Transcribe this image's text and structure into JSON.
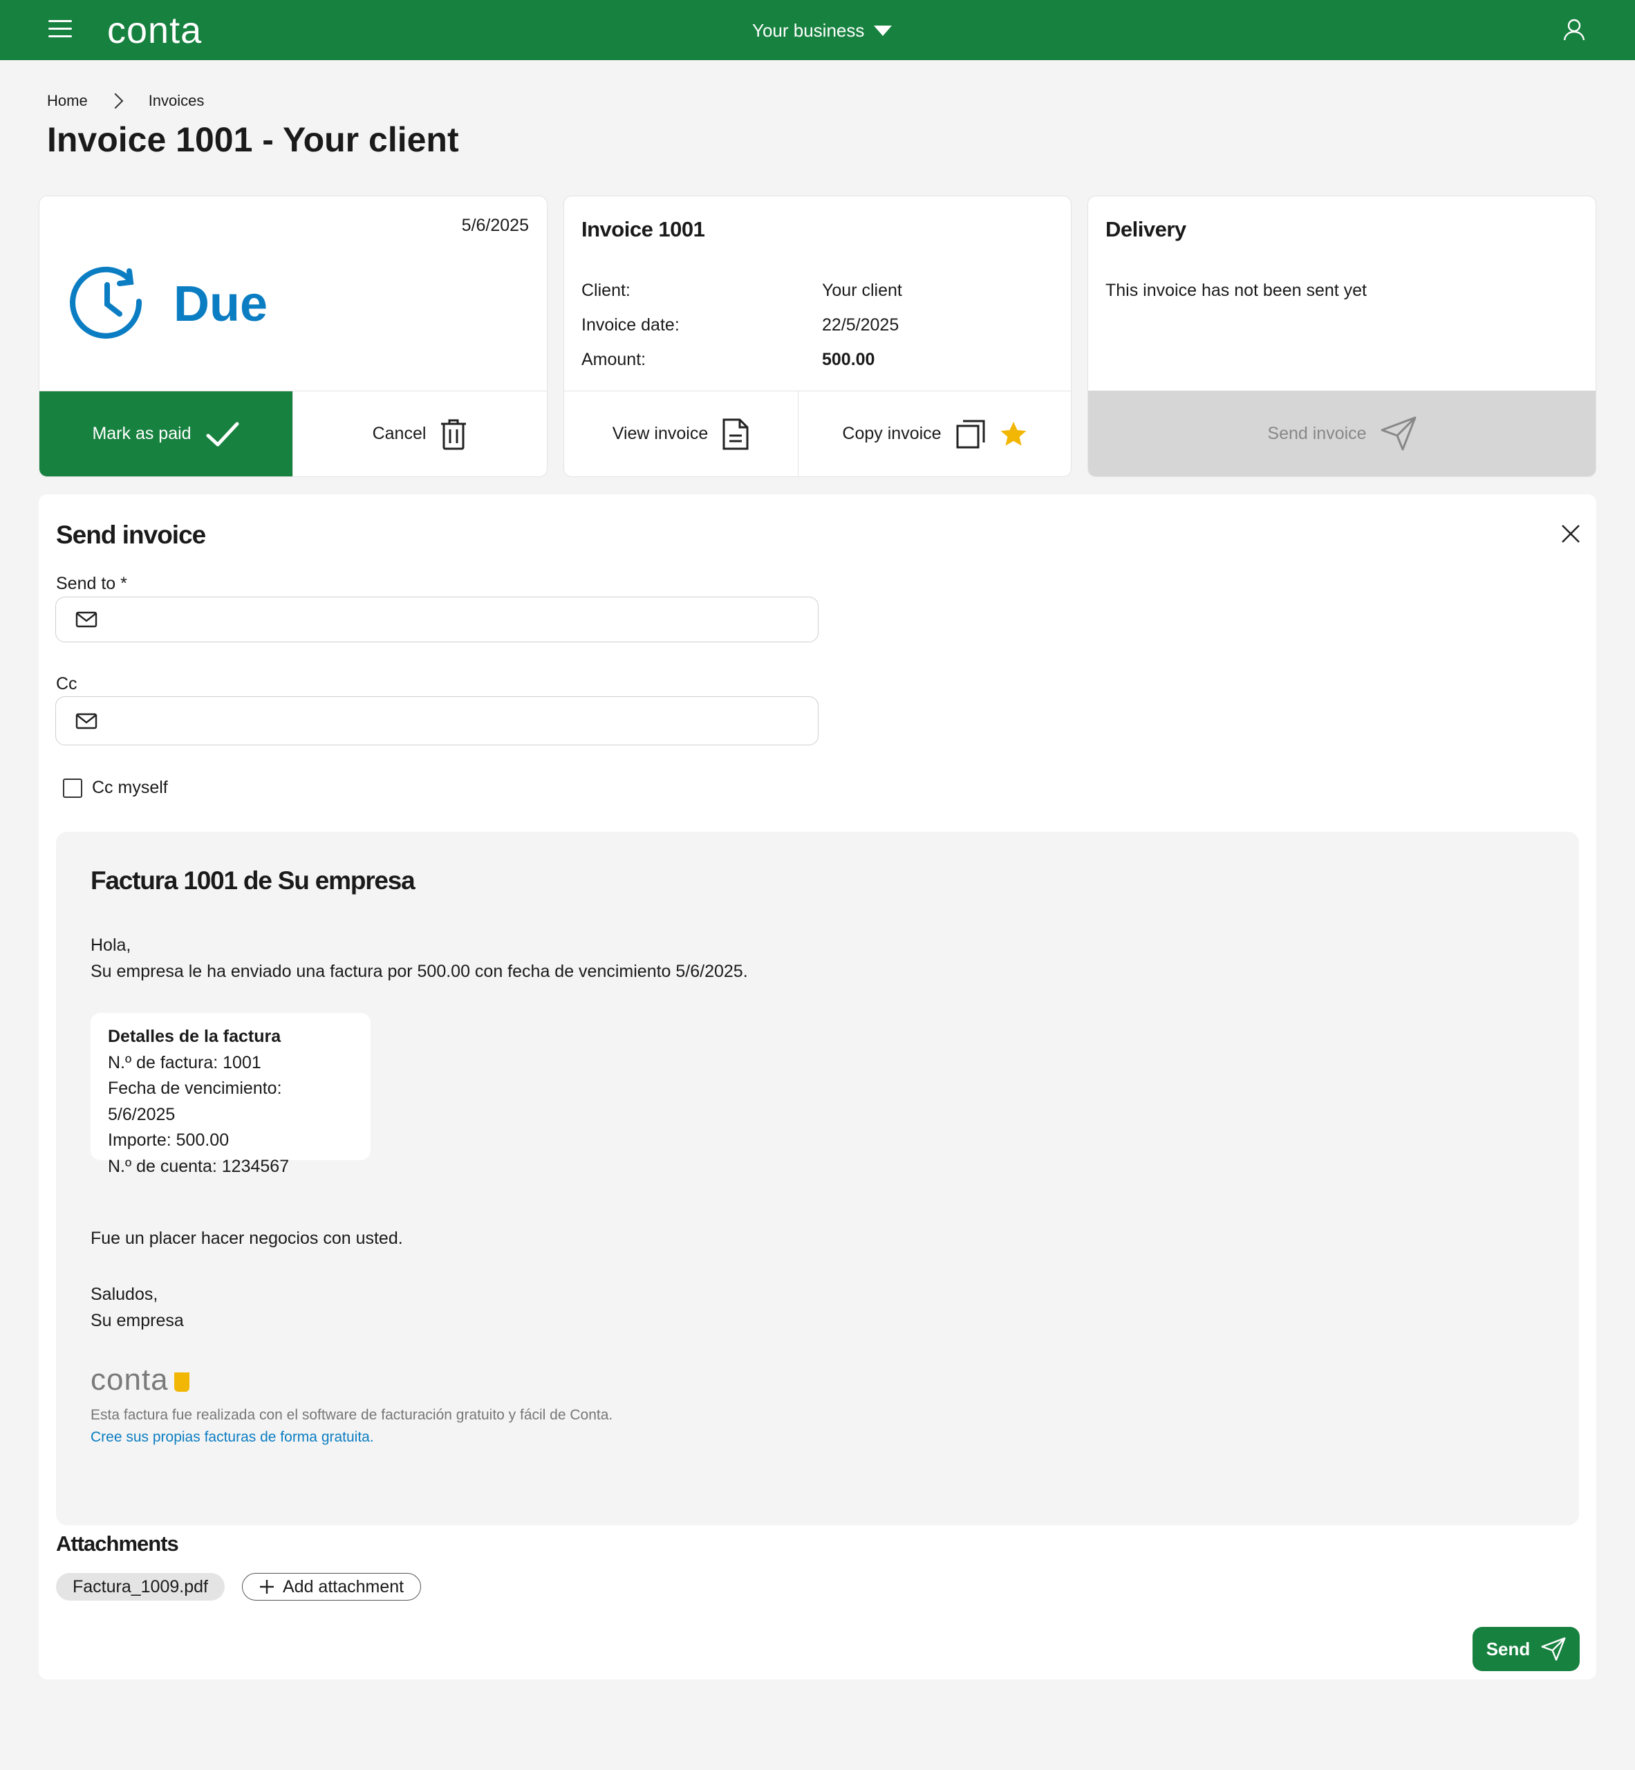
{
  "header": {
    "logo": "conta",
    "business_label": "Your business"
  },
  "breadcrumb": {
    "home": "Home",
    "current": "Invoices"
  },
  "page_title": "Invoice 1001 - Your client",
  "status_card": {
    "date": "5/6/2025",
    "status": "Due",
    "mark_paid_label": "Mark as paid",
    "cancel_label": "Cancel"
  },
  "invoice_card": {
    "title": "Invoice 1001",
    "rows": [
      {
        "label": "Client:",
        "value": "Your client"
      },
      {
        "label": "Invoice date:",
        "value": "22/5/2025"
      },
      {
        "label": "Amount:",
        "value": "500.00"
      }
    ],
    "view_label": "View invoice",
    "copy_label": "Copy invoice"
  },
  "delivery_card": {
    "title": "Delivery",
    "message": "This invoice has not been sent yet",
    "send_label": "Send invoice"
  },
  "send_panel": {
    "title": "Send invoice",
    "send_to_label": "Send to *",
    "send_to_value": "",
    "cc_label": "Cc",
    "cc_value": "",
    "cc_myself_label": "Cc myself",
    "email": {
      "subject": "Factura 1001 de Su empresa",
      "greeting": "Hola,",
      "body": "Su empresa le ha enviado una factura por 500.00 con fecha de vencimiento 5/6/2025.",
      "details_title": "Detalles de la factura",
      "details": [
        "N.º de factura: 1001",
        "Fecha de vencimiento: 5/6/2025",
        "Importe: 500.00",
        "N.º de cuenta: 1234567"
      ],
      "closing": "Fue un placer hacer negocios con usted.",
      "regards": "Saludos,",
      "signature": "Su empresa",
      "brand_logo": "conta",
      "brand_note": "Esta factura fue realizada con el software de facturación gratuito y fácil de Conta.",
      "brand_link": "Cree sus propias facturas de forma gratuita."
    },
    "attachments_title": "Attachments",
    "attachment_file": "Factura_1009.pdf",
    "add_attachment_label": "Add attachment",
    "send_label": "Send"
  },
  "colors": {
    "brand_green": "#17813f",
    "due_blue": "#0b7dc2",
    "star": "#f2b705"
  }
}
